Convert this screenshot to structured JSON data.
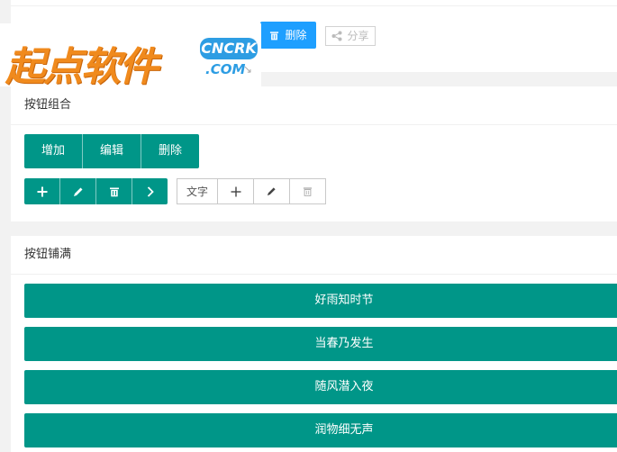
{
  "logo": {
    "text": "起点软件",
    "badge": "CNCRK",
    "domain": ".COM",
    "mark": "↘"
  },
  "top_toolbar": {
    "delete_label": "删除",
    "share_label": "分享"
  },
  "button_group_section": {
    "title": "按钮组合",
    "text_buttons": [
      "增加",
      "编辑",
      "删除"
    ],
    "icon_buttons": [
      "plus-icon",
      "pencil-icon",
      "trash-icon",
      "chevron-right-icon"
    ],
    "primary_group": {
      "text_label": "文字",
      "icons": [
        "plus-icon",
        "pencil-icon",
        "trash-icon"
      ]
    }
  },
  "fluid_section": {
    "title": "按钮铺满",
    "buttons": [
      "好雨知时节",
      "当春乃发生",
      "随风潜入夜",
      "润物细无声"
    ]
  },
  "colors": {
    "green": "#009688",
    "blue": "#1e9fff",
    "logo_orange": "#f08a1d",
    "logo_blue": "#2d9de3"
  }
}
